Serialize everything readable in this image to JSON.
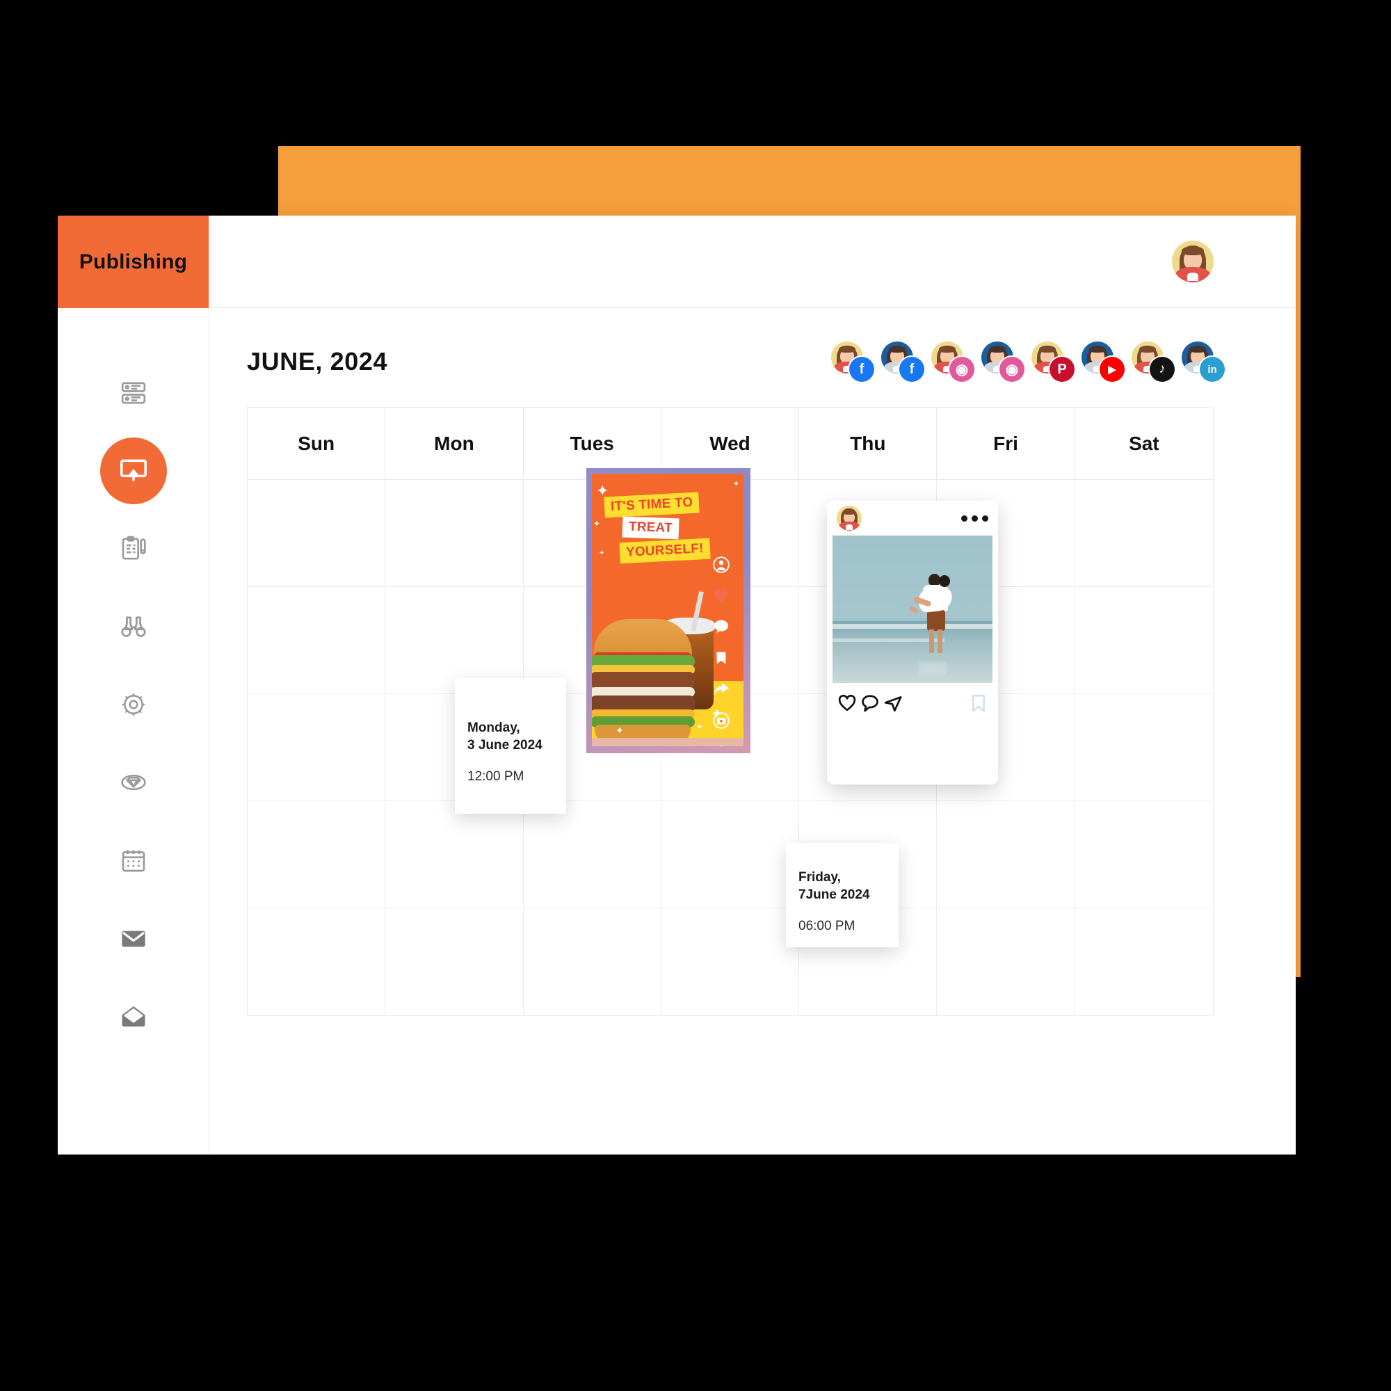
{
  "brand": {
    "title": "Publishing",
    "accent": "#F26B36"
  },
  "sidebar": {
    "items": [
      {
        "name": "dashboard-server",
        "icon": "server-icon",
        "active": false
      },
      {
        "name": "publishing",
        "icon": "presentation-screen-icon",
        "active": true
      },
      {
        "name": "content-planner",
        "icon": "clipboard-pen-icon",
        "active": false
      },
      {
        "name": "monitoring",
        "icon": "binoculars-icon",
        "active": false
      },
      {
        "name": "settings",
        "icon": "gear-icon",
        "active": false
      },
      {
        "name": "rewards",
        "icon": "diamond-icon",
        "active": false
      },
      {
        "name": "calendar",
        "icon": "calendar-icon",
        "active": false
      },
      {
        "name": "inbox",
        "icon": "envelope-closed-icon",
        "active": false
      },
      {
        "name": "messages",
        "icon": "envelope-open-icon",
        "active": false
      }
    ]
  },
  "topbar": {
    "avatar": "user-avatar"
  },
  "calendar": {
    "month_title": "JUNE, 2024",
    "day_headers": [
      "Sun",
      "Mon",
      "Tues",
      "Wed",
      "Thu",
      "Fri",
      "Sat"
    ],
    "week_rows": 5
  },
  "accounts": [
    {
      "network": "Facebook",
      "badge": "facebook",
      "glyph": "f",
      "avatar": "female"
    },
    {
      "network": "Facebook",
      "badge": "facebook",
      "glyph": "f",
      "avatar": "male"
    },
    {
      "network": "Instagram",
      "badge": "instagram",
      "glyph": "◉",
      "avatar": "female"
    },
    {
      "network": "Instagram",
      "badge": "instagram",
      "glyph": "◉",
      "avatar": "male"
    },
    {
      "network": "Pinterest",
      "badge": "pinterest",
      "glyph": "P",
      "avatar": "female"
    },
    {
      "network": "YouTube",
      "badge": "youtube",
      "glyph": "▶",
      "avatar": "male"
    },
    {
      "network": "TikTok",
      "badge": "tiktok",
      "glyph": "♪",
      "avatar": "female"
    },
    {
      "network": "LinkedIn",
      "badge": "linkedin",
      "glyph": "in",
      "avatar": "male"
    }
  ],
  "scheduled_posts": [
    {
      "id": "monday-post",
      "day": "Monday,",
      "date": "3 June 2024",
      "time": "12:00 PM",
      "creative": {
        "type": "story",
        "headline_lines": [
          "IT'S TIME TO",
          "TREAT",
          "YOURSELF!"
        ],
        "background_color": "#F4682C",
        "frame_color": "#8F8CCB",
        "actions": [
          "profile-icon",
          "heart-icon",
          "comment-icon",
          "bookmark-icon",
          "share-icon",
          "camera-icon",
          "person-icon"
        ]
      }
    },
    {
      "id": "friday-post",
      "day": "Friday,",
      "date": "7June 2024",
      "time": "06:00 PM",
      "creative": {
        "type": "instagram-post",
        "photo_alt": "couple on beach",
        "actions": [
          "heart-icon",
          "comment-icon",
          "send-icon",
          "bookmark-icon"
        ]
      }
    }
  ],
  "colors": {
    "accent_orange": "#F26B36",
    "bg_orange": "#F59E3C",
    "canvas_black": "#000000",
    "grid_line": "#ededed"
  }
}
